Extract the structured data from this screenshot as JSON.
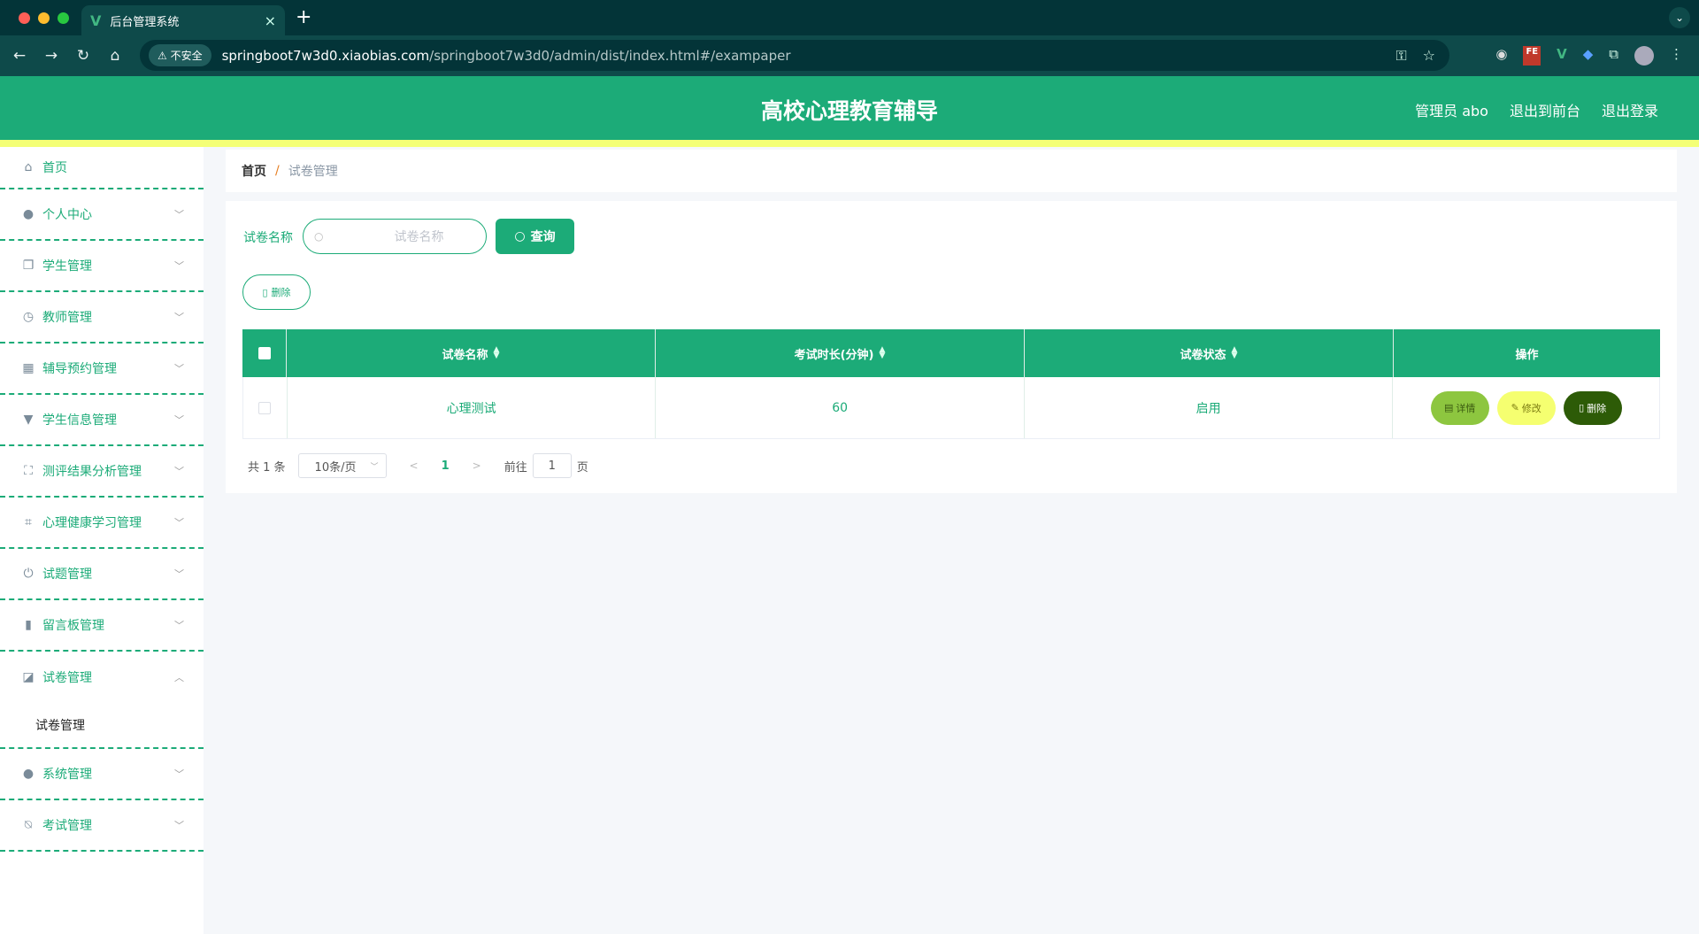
{
  "browser": {
    "tab_title": "后台管理系统",
    "security_label": "不安全",
    "url_host": "springboot7w3d0.xiaobias.com",
    "url_path": "/springboot7w3d0/admin/dist/index.html#/exampaper"
  },
  "header": {
    "title": "高校心理教育辅导",
    "user_label": "管理员 abo",
    "front_link": "退出到前台",
    "logout_link": "退出登录",
    "accent_color": "#1cab78",
    "stripe_color": "#f4ff76"
  },
  "sidebar": {
    "items": [
      {
        "label": "首页",
        "icon": "home-icon"
      },
      {
        "label": "个人中心",
        "icon": "user-icon"
      },
      {
        "label": "学生管理",
        "icon": "copy-icon"
      },
      {
        "label": "教师管理",
        "icon": "clock-icon"
      },
      {
        "label": "辅导预约管理",
        "icon": "grid-icon"
      },
      {
        "label": "学生信息管理",
        "icon": "brush-icon"
      },
      {
        "label": "测评结果分析管理",
        "icon": "fullscreen-icon"
      },
      {
        "label": "心理健康学习管理",
        "icon": "crop-icon"
      },
      {
        "label": "试题管理",
        "icon": "power-icon"
      },
      {
        "label": "留言板管理",
        "icon": "chart-bar-icon"
      },
      {
        "label": "试卷管理",
        "icon": "chart-line-icon"
      },
      {
        "label": "系统管理",
        "icon": "user-icon"
      },
      {
        "label": "考试管理",
        "icon": "bell-off-icon"
      }
    ],
    "submenu_label": "试卷管理"
  },
  "breadcrumb": {
    "home": "首页",
    "separator": "/",
    "current": "试卷管理"
  },
  "search": {
    "label": "试卷名称",
    "placeholder": "试卷名称",
    "query_button": "查询",
    "delete_button": "删除"
  },
  "table": {
    "columns": [
      "试卷名称",
      "考试时长(分钟)",
      "试卷状态",
      "操作"
    ],
    "rows": [
      {
        "name": "心理测试",
        "duration": "60",
        "status": "启用"
      }
    ],
    "actions": {
      "detail": "详情",
      "edit": "修改",
      "delete": "删除"
    }
  },
  "pagination": {
    "total": "共 1 条",
    "page_size": "10条/页",
    "current_page": "1",
    "goto_label": "前往",
    "goto_value": "1",
    "page_suffix": "页"
  }
}
